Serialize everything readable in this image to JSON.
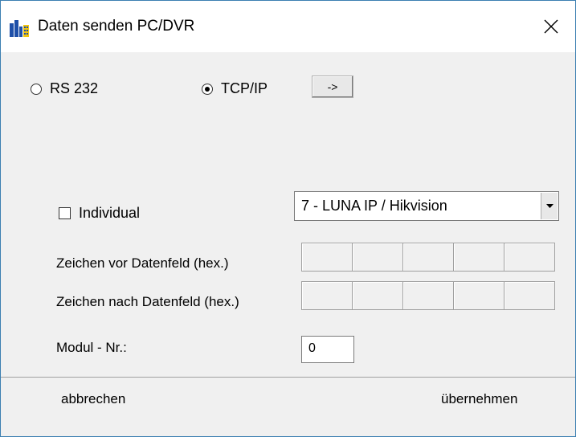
{
  "window": {
    "title": "Daten senden PC/DVR"
  },
  "connection": {
    "rs232_label": "RS 232",
    "tcpip_label": "TCP/IP",
    "selected": "TCP/IP",
    "arrow_button_label": "->"
  },
  "individual": {
    "label": "Individual",
    "checked": false
  },
  "device_select": {
    "value": "7 - LUNA IP / Hikvision"
  },
  "fields": {
    "before_label": "Zeichen vor Datenfeld (hex.)",
    "before_values": [
      "",
      "",
      "",
      "",
      ""
    ],
    "after_label": "Zeichen nach Datenfeld (hex.)",
    "after_values": [
      "",
      "",
      "",
      "",
      ""
    ],
    "modul_label": "Modul - Nr.:",
    "modul_value": "0"
  },
  "footer": {
    "cancel_label": "abbrechen",
    "apply_label": "übernehmen"
  },
  "icons": {
    "app": "app-icon",
    "close": "close-icon",
    "dropdown": "chevron-down-icon"
  },
  "colors": {
    "window_border": "#3c7fb1",
    "app_icon_blue": "#1e4fa8",
    "app_icon_yellow": "#f1c40f"
  }
}
